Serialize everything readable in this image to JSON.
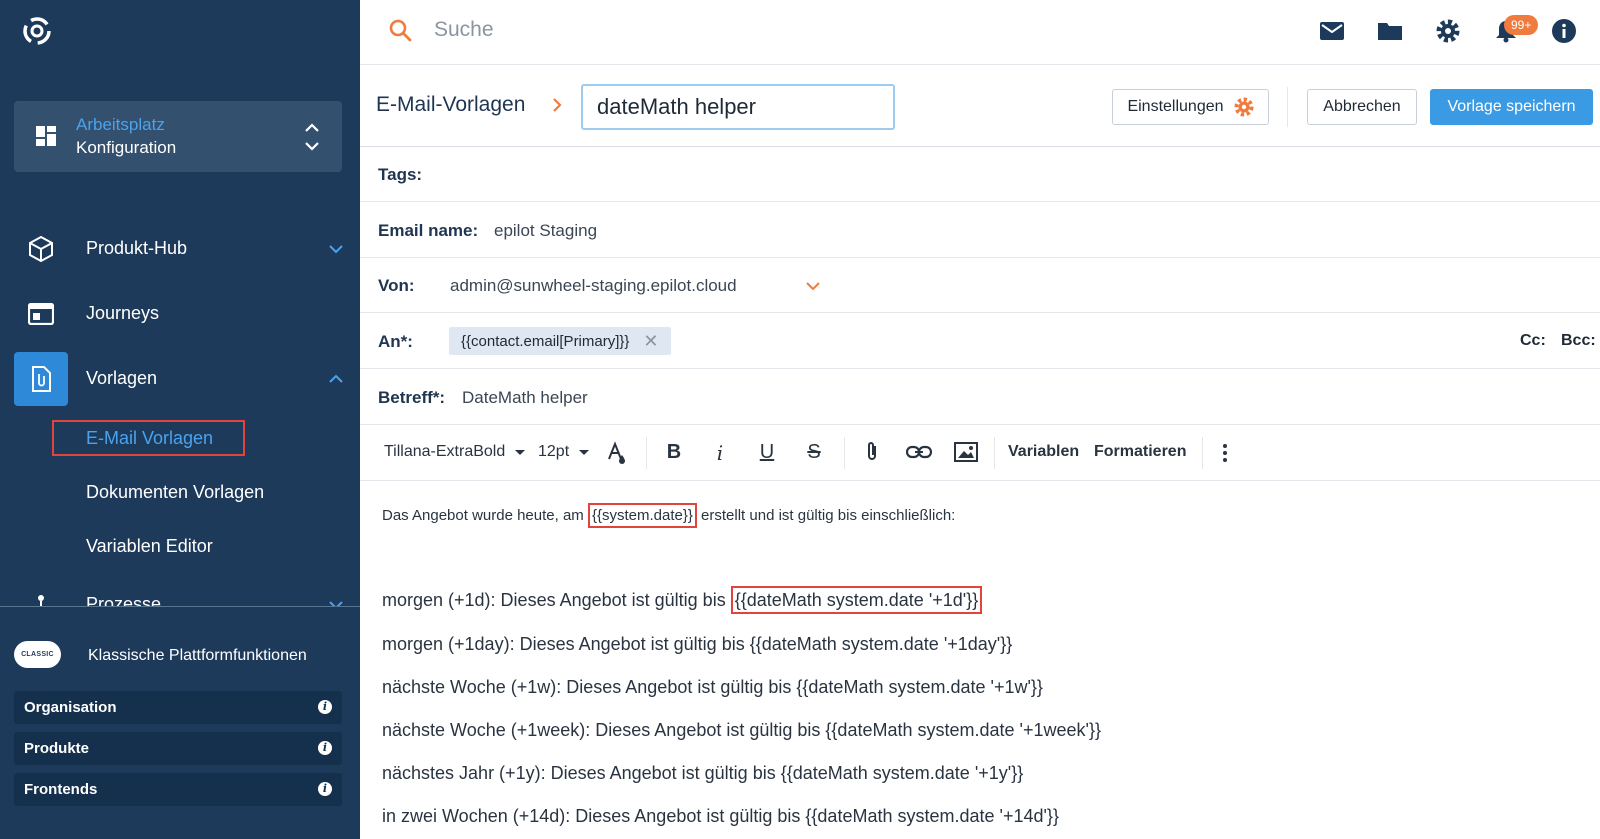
{
  "sidebar": {
    "workspace": {
      "title": "Arbeitsplatz",
      "subtitle": "Konfiguration"
    },
    "nav": [
      {
        "label": "Produkt-Hub",
        "icon": "cube-icon"
      },
      {
        "label": "Journeys",
        "icon": "browser-window-icon"
      },
      {
        "label": "Vorlagen",
        "icon": "document-clip-icon"
      },
      {
        "label": "Prozesse",
        "icon": "process-icon"
      }
    ],
    "vorlagen_items": [
      "E-Mail Vorlagen",
      "Dokumenten Vorlagen",
      "Variablen Editor"
    ],
    "classic": {
      "badge": "CLASSIC",
      "label": "Klassische Plattformfunktionen"
    },
    "legacy": [
      "Organisation",
      "Produkte",
      "Frontends"
    ]
  },
  "topbar": {
    "search_placeholder": "Suche",
    "notification_count": "99+"
  },
  "header": {
    "breadcrumb": "E-Mail-Vorlagen",
    "template_name": "dateMath helper",
    "settings_label": "Einstellungen",
    "cancel_label": "Abbrechen",
    "save_label": "Vorlage speichern"
  },
  "form": {
    "tags_label": "Tags:",
    "email_name_label": "Email name:",
    "email_name_value": "epilot Staging",
    "from_label": "Von:",
    "from_value": "admin@sunwheel-staging.epilot.cloud",
    "to_label": "An*:",
    "to_chip": "{{contact.email[Primary]}}",
    "cc_label": "Cc:",
    "bcc_label": "Bcc:",
    "subject_label": "Betreff*:",
    "subject_value": "DateMath helper"
  },
  "toolbar": {
    "font": "Tillana-ExtraBold",
    "size": "12pt",
    "variables_label": "Variablen",
    "format_label": "Formatieren"
  },
  "body": {
    "line1_pre": "Das Angebot wurde heute, am ",
    "line1_var": "{{system.date}}",
    "line1_post": " erstellt und ist gültig bis einschließlich:",
    "line2_pre": "morgen (+1d): Dieses Angebot ist gültig bis ",
    "line2_var": "{{dateMath system.date '+1d'}}",
    "lines": [
      "morgen (+1day): Dieses Angebot ist gültig bis {{dateMath system.date '+1day'}}",
      "nächste Woche (+1w): Dieses Angebot ist gültig bis {{dateMath system.date '+1w'}}",
      "nächste Woche (+1week): Dieses Angebot ist gültig bis {{dateMath system.date '+1week'}}",
      "nächstes Jahr (+1y): Dieses Angebot ist gültig bis {{dateMath system.date '+1y'}}",
      "in zwei Wochen (+14d): Dieses Angebot ist gültig bis {{dateMath system.date '+14d'}}"
    ]
  },
  "colors": {
    "sidebar_bg": "#1e3a5a",
    "accent_blue": "#3a9be4",
    "accent_orange": "#f07b3f",
    "highlight_red": "#e0443b"
  }
}
